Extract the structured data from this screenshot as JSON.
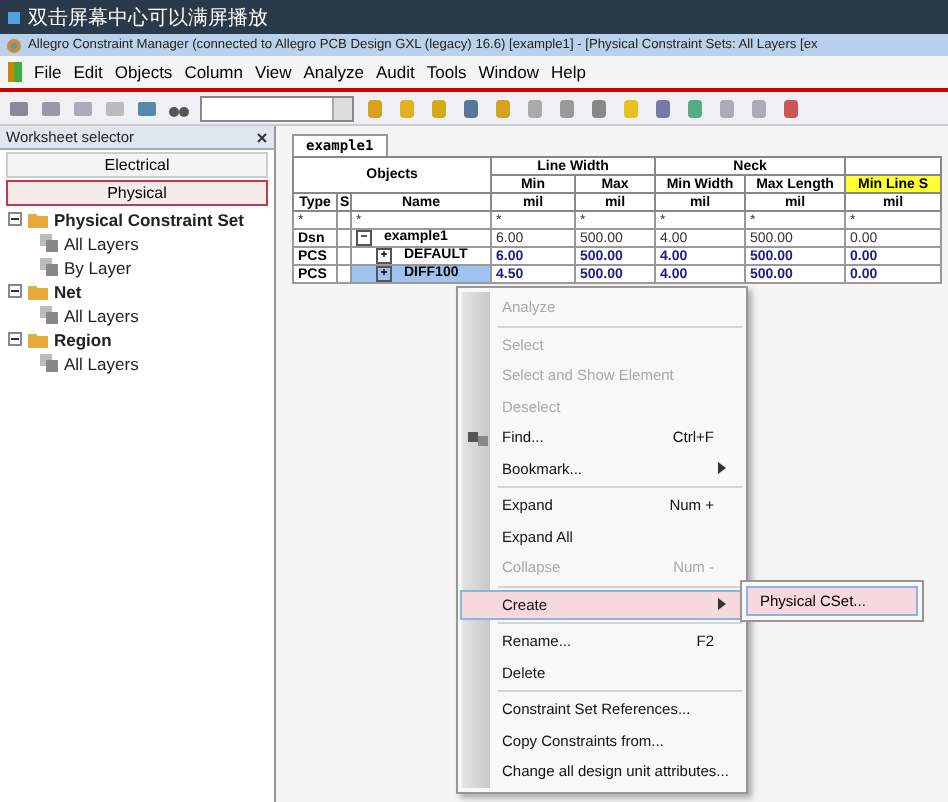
{
  "screen_bar": {
    "title": "双击屏幕中心可以满屏播放"
  },
  "window": {
    "title": "Allegro Constraint Manager (connected to Allegro PCB Design GXL (legacy) 16.6) [example1] - [Physical Constraint Sets:  All Layers [ex"
  },
  "menu": [
    "File",
    "Edit",
    "Objects",
    "Column",
    "View",
    "Analyze",
    "Audit",
    "Tools",
    "Window",
    "Help"
  ],
  "worksheet_selector": {
    "title": "Worksheet selector",
    "buttons": [
      {
        "label": "Electrical",
        "selected": false
      },
      {
        "label": "Physical",
        "selected": true
      }
    ],
    "tree": [
      {
        "label": "Physical Constraint Set",
        "expanded": true,
        "children": [
          {
            "label": "All Layers"
          },
          {
            "label": "By Layer"
          }
        ]
      },
      {
        "label": "Net",
        "expanded": true,
        "children": [
          {
            "label": "All Layers"
          }
        ]
      },
      {
        "label": "Region",
        "expanded": true,
        "children": [
          {
            "label": "All Layers"
          }
        ]
      }
    ]
  },
  "sheet_tab": "example1",
  "table": {
    "groups": [
      {
        "label": "Line Width"
      },
      {
        "label": "Neck"
      }
    ],
    "objects_header": "Objects",
    "columns": [
      {
        "label": "Min",
        "unit": "mil",
        "highlighted": false
      },
      {
        "label": "Max",
        "unit": "mil",
        "highlighted": false
      },
      {
        "label": "Min Width",
        "unit": "mil",
        "highlighted": false
      },
      {
        "label": "Max Length",
        "unit": "mil",
        "highlighted": false
      },
      {
        "label": "Min Line S",
        "unit": "mil",
        "highlighted": true
      }
    ],
    "type_header": "Type",
    "s_header": "S",
    "name_header": "Name",
    "filter": "*",
    "rows": [
      {
        "type": "Dsn",
        "toggle": "−",
        "name": "example1",
        "kind": "design",
        "selected": false,
        "values": [
          "6.00",
          "500.00",
          "4.00",
          "500.00",
          "0.00"
        ]
      },
      {
        "type": "PCS",
        "toggle": "+",
        "name": "DEFAULT",
        "kind": "cset",
        "selected": false,
        "values": [
          "6.00",
          "500.00",
          "4.00",
          "500.00",
          "0.00"
        ]
      },
      {
        "type": "PCS",
        "toggle": "+",
        "name": "DIFF100",
        "kind": "cset",
        "selected": true,
        "values": [
          "4.50",
          "500.00",
          "4.00",
          "500.00",
          "0.00"
        ]
      }
    ]
  },
  "context_menu": [
    {
      "kind": "item",
      "label": "Analyze",
      "disabled": true
    },
    {
      "kind": "separator"
    },
    {
      "kind": "item",
      "label": "Select",
      "disabled": true
    },
    {
      "kind": "item",
      "label": "Select and Show Element",
      "disabled": true
    },
    {
      "kind": "item",
      "label": "Deselect",
      "disabled": true
    },
    {
      "kind": "item",
      "label": "Find...",
      "shortcut": "Ctrl+F",
      "disabled": false,
      "icon": true
    },
    {
      "kind": "item",
      "label": "Bookmark...",
      "disabled": false,
      "submenu": true
    },
    {
      "kind": "separator"
    },
    {
      "kind": "item",
      "label": "Expand",
      "shortcut": "Num +",
      "disabled": false
    },
    {
      "kind": "item",
      "label": "Expand All",
      "disabled": false
    },
    {
      "kind": "item",
      "label": "Collapse",
      "shortcut": "Num -",
      "disabled": true
    },
    {
      "kind": "separator"
    },
    {
      "kind": "item",
      "label": "Create",
      "disabled": false,
      "submenu": true,
      "selected": true
    },
    {
      "kind": "separator"
    },
    {
      "kind": "item",
      "label": "Rename...",
      "shortcut": "F2",
      "disabled": false
    },
    {
      "kind": "item",
      "label": "Delete",
      "disabled": false
    },
    {
      "kind": "separator"
    },
    {
      "kind": "item",
      "label": "Constraint Set References...",
      "disabled": false
    },
    {
      "kind": "item",
      "label": "Copy Constraints from...",
      "disabled": false
    },
    {
      "kind": "item",
      "label": "Change all design unit attributes...",
      "disabled": false
    }
  ],
  "submenu": [
    {
      "label": "Physical CSet...",
      "selected": true
    }
  ]
}
